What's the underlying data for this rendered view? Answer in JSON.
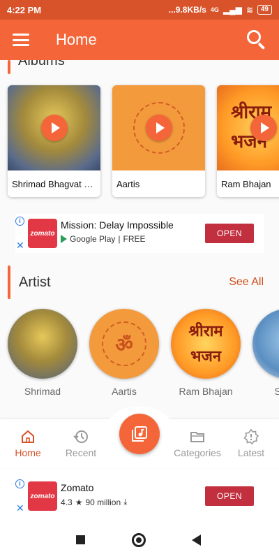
{
  "status_bar": {
    "time": "4:22 PM",
    "speed": "...9.8KB/s",
    "network": "4G",
    "battery": "49"
  },
  "app_bar": {
    "title": "Home"
  },
  "albums": {
    "section_title": "Albums",
    "items": [
      {
        "label": "Shrimad Bhagvat Gita"
      },
      {
        "label": "Aartis"
      },
      {
        "label": "Ram Bhajan"
      }
    ],
    "thumb_text_ram": "श्रीराम भजन"
  },
  "ad_top": {
    "logo": "zomato",
    "title": "Mission: Delay Impossible",
    "store": "Google Play",
    "sep": "|",
    "price": "FREE",
    "cta": "OPEN"
  },
  "artist": {
    "section_title": "Artist",
    "see_all": "See All",
    "items": [
      {
        "label": "Shrimad"
      },
      {
        "label": "Aartis"
      },
      {
        "label": "Ram Bhajan"
      },
      {
        "label": "Shree"
      }
    ],
    "circle_text_ram": "श्रीराम भजन",
    "circle_text_om": "ॐ"
  },
  "bottom_nav": {
    "items": [
      {
        "label": "Home",
        "icon": "home-icon",
        "active": true
      },
      {
        "label": "Recent",
        "icon": "history-icon",
        "active": false
      },
      {
        "label": "Categories",
        "icon": "folder-icon",
        "active": false
      },
      {
        "label": "Latest",
        "icon": "new-badge-icon",
        "active": false
      }
    ],
    "fab_icon": "music-library-icon"
  },
  "ad_bottom": {
    "logo": "zomato",
    "title": "Zomato",
    "rating": "4.3",
    "installs": "90 million",
    "cta": "OPEN"
  },
  "colors": {
    "primary": "#f4663a",
    "status": "#d8532a",
    "ad_cta": "#c2303f"
  }
}
